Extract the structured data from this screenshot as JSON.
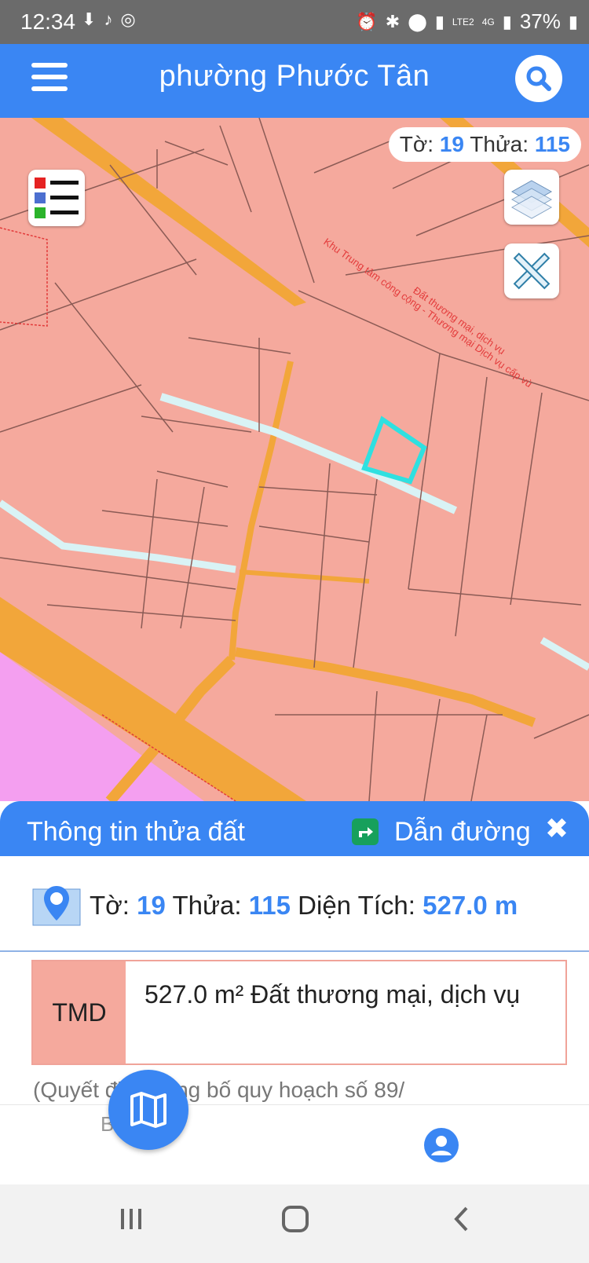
{
  "status": {
    "time": "12:34",
    "battery": "37%",
    "network": "4G",
    "volte": "LTE2"
  },
  "appbar": {
    "title": "phường Phước Tân"
  },
  "map": {
    "chip": {
      "to_label": "Tờ:",
      "to_value": "19",
      "thua_label": "Thửa:",
      "thua_value": "115"
    },
    "labels": {
      "zone": "Khu Trung tâm công cộng - Thương mại Dịch vụ cấp vù",
      "landuse": "Đất thương mại, dịch vụ"
    }
  },
  "sheet": {
    "title": "Thông tin thửa đất",
    "route": "Dẫn đường",
    "close": "✖",
    "info": {
      "to_label": "Tờ:",
      "to_value": "19",
      "thua_label": "Thửa:",
      "thua_value": "115",
      "area_label": "Diện Tích:",
      "area_value": "527.0 m"
    },
    "landuse": {
      "code": "TMD",
      "description": "527.0 m²  Đất thương mại, dịch vụ"
    },
    "decision": "(Quyết định công bố quy hoạch số 89/"
  },
  "nav": {
    "left_label": "Bản đồ"
  },
  "colors": {
    "primary": "#3a86f3",
    "land": "#f5a99d",
    "road": "#f2a63a",
    "highlight": "#2fe0e0",
    "pink_zone": "#f49ff0"
  }
}
